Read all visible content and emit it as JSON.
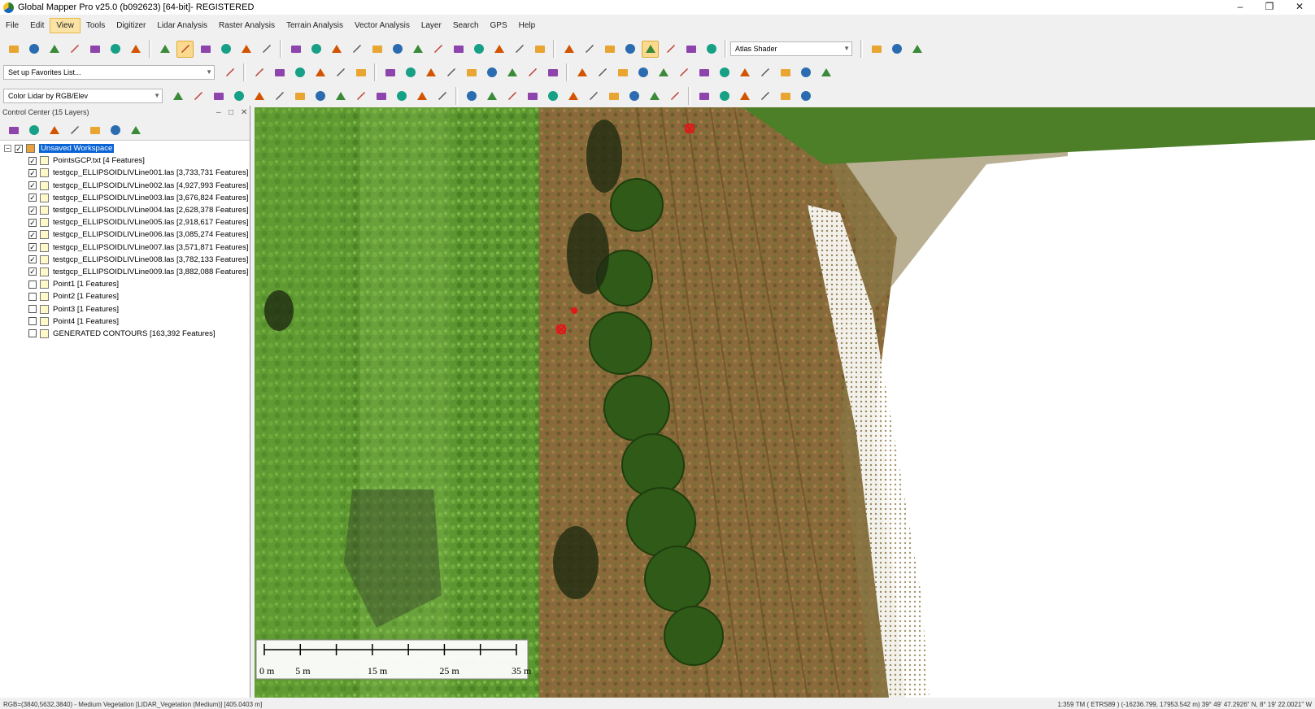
{
  "window": {
    "title": "Global Mapper Pro v25.0 (b092623) [64-bit]- REGISTERED",
    "minimize": "–",
    "restore": "❐",
    "close": "✕"
  },
  "menu": [
    "File",
    "Edit",
    "View",
    "Tools",
    "Digitizer",
    "Lidar Analysis",
    "Raster Analysis",
    "Terrain Analysis",
    "Vector Analysis",
    "Layer",
    "Search",
    "GPS",
    "Help"
  ],
  "menu_active": "View",
  "toolbar": {
    "shader_select": "Atlas Shader",
    "favorites_select": "Set up Favorites List...",
    "lidar_color_select": "Color Lidar by RGB/Elev"
  },
  "control_center": {
    "title": "Control Center (15 Layers)",
    "root": "Unsaved Workspace",
    "layers": [
      {
        "name": "PointsGCP.txt [4 Features]",
        "checked": true
      },
      {
        "name": "testgcp_ELLIPSOIDLIVLine001.las [3,733,731 Features]",
        "checked": true
      },
      {
        "name": "testgcp_ELLIPSOIDLIVLine002.las [4,927,993 Features]",
        "checked": true
      },
      {
        "name": "testgcp_ELLIPSOIDLIVLine003.las [3,676,824 Features]",
        "checked": true
      },
      {
        "name": "testgcp_ELLIPSOIDLIVLine004.las [2,628,378 Features]",
        "checked": true
      },
      {
        "name": "testgcp_ELLIPSOIDLIVLine005.las [2,918,617 Features]",
        "checked": true
      },
      {
        "name": "testgcp_ELLIPSOIDLIVLine006.las [3,085,274 Features]",
        "checked": true
      },
      {
        "name": "testgcp_ELLIPSOIDLIVLine007.las [3,571,871 Features]",
        "checked": true
      },
      {
        "name": "testgcp_ELLIPSOIDLIVLine008.las [3,782,133 Features]",
        "checked": true
      },
      {
        "name": "testgcp_ELLIPSOIDLIVLine009.las [3,882,088 Features]",
        "checked": true
      },
      {
        "name": "Point1 [1 Features]",
        "checked": false
      },
      {
        "name": "Point2 [1 Features]",
        "checked": false
      },
      {
        "name": "Point3 [1 Features]",
        "checked": false
      },
      {
        "name": "Point4 [1 Features]",
        "checked": false
      },
      {
        "name": "GENERATED CONTOURS [163,392 Features]",
        "checked": false
      }
    ]
  },
  "scale_bar": {
    "labels": [
      "0 m",
      "5 m",
      "15 m",
      "25 m",
      "35 m"
    ]
  },
  "status": {
    "left": "RGB=(3840,5632,3840) - Medium Vegetation [LIDAR_Vegetation (Medium)] [405.0403 m]",
    "right": "1:359  TM ( ETRS89 ) (-16236.799, 17953.542 m)  39° 49' 47.2926\" N, 8° 19' 22.0021\" W"
  },
  "colors": {
    "selection": "#0a64d6",
    "active_menu": "#fbe3a6",
    "gcp_marker": "#e01818"
  }
}
